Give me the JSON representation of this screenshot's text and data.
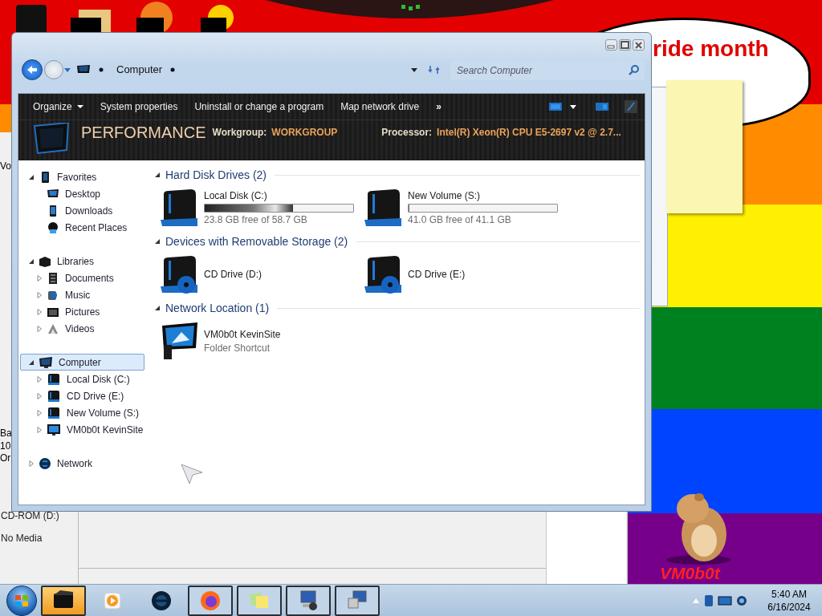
{
  "wallpaper": {
    "bubble_text": "ride month",
    "mascot_text": "VM0b0t"
  },
  "background_window": {
    "fragments": [
      "Vo",
      "Ba",
      "10",
      "Or"
    ],
    "drive_label": "CD-ROM (D:)",
    "drive_status": "No Media"
  },
  "explorer": {
    "address": {
      "crumbs": [
        "Computer"
      ],
      "search_placeholder": "Search Computer"
    },
    "toolbar": [
      {
        "label": "Organize",
        "kind": "menu"
      },
      {
        "label": "System properties",
        "kind": "button"
      },
      {
        "label": "Uninstall or change a program",
        "kind": "button"
      },
      {
        "label": "Map network drive",
        "kind": "button"
      },
      {
        "label": "»",
        "kind": "overflow"
      }
    ],
    "header": {
      "computer_name": "PERFORMANCE",
      "details": [
        {
          "label": "Workgroup:",
          "value": "WORKGROUP"
        },
        {
          "label": "Processor:",
          "value": "Intel(R) Xeon(R) CPU E5-2697 v2 @ 2.7..."
        }
      ]
    },
    "navigation": [
      {
        "label": "Favorites",
        "kind": "favorites",
        "expanded": true,
        "selected": false,
        "children": [
          {
            "label": "Desktop",
            "kind": "desktop",
            "selected": false
          },
          {
            "label": "Downloads",
            "kind": "downloads",
            "selected": false
          },
          {
            "label": "Recent Places",
            "kind": "recent",
            "selected": false
          }
        ]
      },
      {
        "label": "Libraries",
        "kind": "libraries",
        "expanded": true,
        "selected": false,
        "children": [
          {
            "label": "Documents",
            "kind": "documents",
            "expanded": false,
            "selected": false
          },
          {
            "label": "Music",
            "kind": "music",
            "expanded": false,
            "selected": false
          },
          {
            "label": "Pictures",
            "kind": "pictures",
            "expanded": false,
            "selected": false
          },
          {
            "label": "Videos",
            "kind": "videos",
            "expanded": false,
            "selected": false
          }
        ]
      },
      {
        "label": "Computer",
        "kind": "computer",
        "expanded": true,
        "selected": true,
        "children": [
          {
            "label": "Local Disk (C:)",
            "kind": "disk",
            "expanded": false,
            "selected": false
          },
          {
            "label": "CD Drive (E:)",
            "kind": "disk",
            "expanded": false,
            "selected": false
          },
          {
            "label": "New Volume (S:)",
            "kind": "disk",
            "expanded": false,
            "selected": false
          },
          {
            "label": "VM0b0t KevinSite",
            "kind": "shortcut",
            "expanded": false,
            "selected": false
          }
        ]
      },
      {
        "label": "Network",
        "kind": "network",
        "expanded": false,
        "selected": false
      }
    ],
    "groups": [
      {
        "title": "Hard Disk Drives (2)",
        "expanded": true,
        "items": [
          {
            "kind": "disk",
            "name": "Local Disk (C:)",
            "level": 0.595,
            "info": "23.8 GB free of 58.7 GB"
          },
          {
            "kind": "disk",
            "name": "New Volume (S:)",
            "level": 0.003,
            "info": "41.0 GB free of 41.1 GB"
          }
        ]
      },
      {
        "title": "Devices with Removable Storage (2)",
        "expanded": true,
        "items": [
          {
            "kind": "cd",
            "name": "CD Drive (D:)"
          },
          {
            "kind": "cd",
            "name": "CD Drive (E:)"
          }
        ]
      },
      {
        "title": "Network Location (1)",
        "expanded": true,
        "items": [
          {
            "kind": "shortcut",
            "name": "VM0b0t KevinSite",
            "info": "Folder Shortcut"
          }
        ]
      }
    ]
  },
  "taskbar": {
    "buttons": [
      {
        "kind": "box",
        "active": true,
        "running": true
      },
      {
        "kind": "media",
        "active": false,
        "running": false
      },
      {
        "kind": "globe",
        "active": false,
        "running": false
      },
      {
        "kind": "browser",
        "active": false,
        "running": true
      },
      {
        "kind": "notes",
        "active": false,
        "running": true
      },
      {
        "kind": "computer",
        "active": false,
        "running": true
      },
      {
        "kind": "network",
        "active": false,
        "running": true
      }
    ],
    "clock": {
      "time": "5:40 AM",
      "date": "6/16/2024"
    }
  }
}
